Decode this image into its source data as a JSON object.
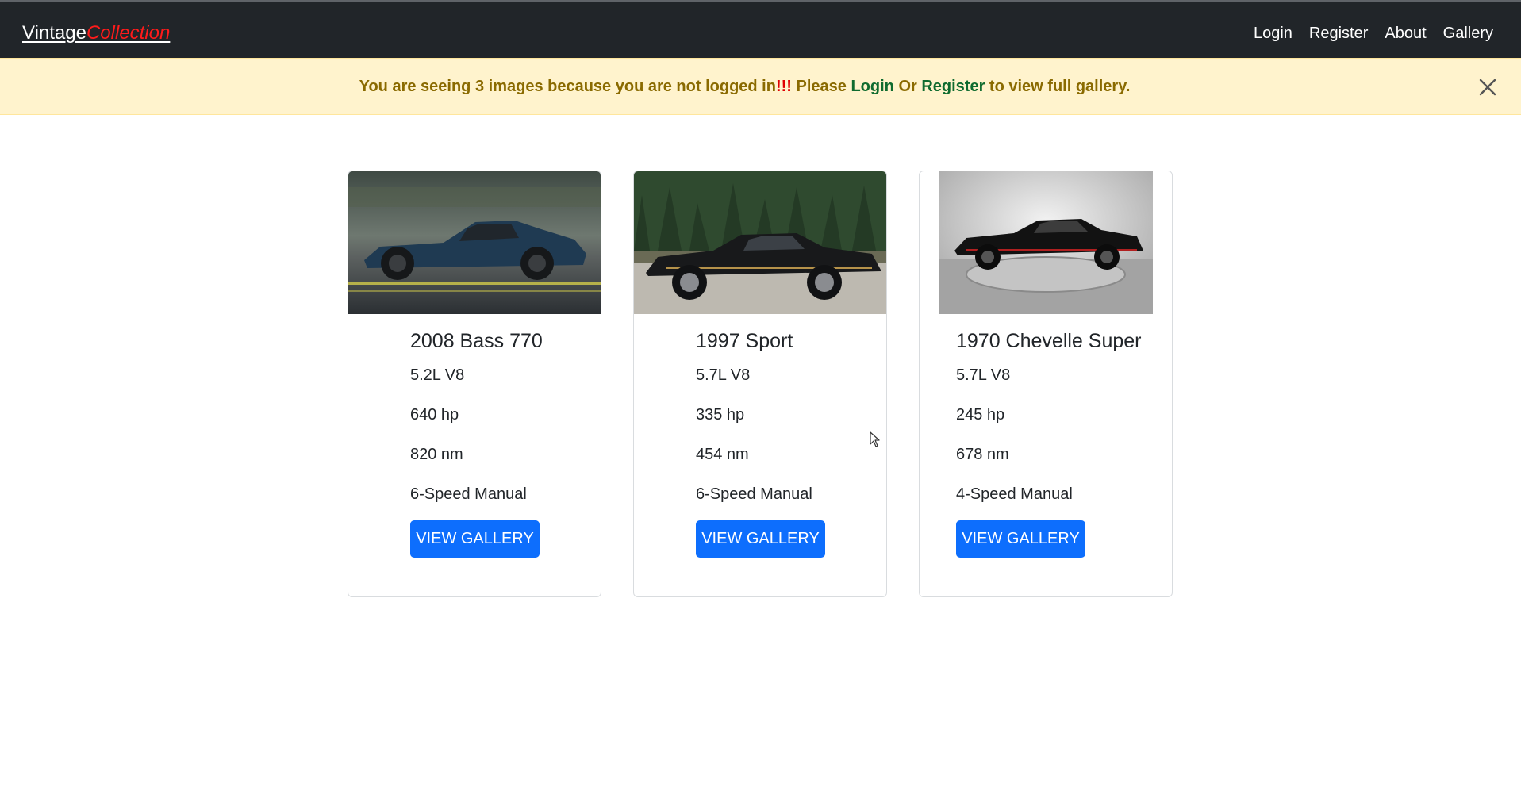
{
  "navbar": {
    "brand_part1": "Vintage",
    "brand_part2": "Collection",
    "links": [
      "Login",
      "Register",
      "About",
      "Gallery"
    ]
  },
  "alert": {
    "text1": "You are seeing 3 images because you are not logged in",
    "bang": "!!!",
    "text2": " Please ",
    "login_link": "Login",
    "text3": " Or ",
    "register_link": "Register",
    "text4": " to view full gallery."
  },
  "cars": [
    {
      "title": "2008 Bass 770",
      "engine": "5.2L V8",
      "power": "640 hp",
      "torque": "820 nm",
      "transmission": "6-Speed Manual",
      "button": "VIEW GALLERY",
      "body_color": "#1f3a52"
    },
    {
      "title": "1997 Sport",
      "engine": "5.7L V8",
      "power": "335 hp",
      "torque": "454 nm",
      "transmission": "6-Speed Manual",
      "button": "VIEW GALLERY",
      "body_color": "#18191b"
    },
    {
      "title": "1970 Chevelle Super",
      "engine": "5.7L V8",
      "power": "245 hp",
      "torque": "678 nm",
      "transmission": "4-Speed Manual",
      "button": "VIEW GALLERY",
      "body_color": "#121212"
    }
  ],
  "icons": {
    "alert_close": "close-icon",
    "pointer": "mouse-cursor-icon"
  }
}
